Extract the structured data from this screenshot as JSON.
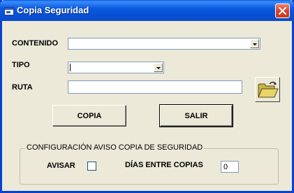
{
  "window": {
    "title": "Copia Seguridad",
    "icons": {
      "app": "app-window-icon",
      "close": "close-icon"
    }
  },
  "form": {
    "contenido": {
      "label": "CONTENIDO",
      "value": ""
    },
    "tipo": {
      "label": "TIPO",
      "value": ""
    },
    "ruta": {
      "label": "RUTA",
      "value": "",
      "browse_icon": "open-folder-icon"
    }
  },
  "buttons": {
    "copia": "COPIA",
    "salir": "SALIR"
  },
  "group": {
    "legend": "CONFIGURACIÓN AVISO COPIA DE SEGURIDAD",
    "avisar": {
      "label": "AVISAR",
      "checked": false
    },
    "dias": {
      "label": "DÍAS ENTRE COPIAS",
      "value": "0"
    }
  },
  "colors": {
    "titlebar": "#0a5ae0",
    "dialog_bg": "#ece9d8",
    "close_button": "#d9442a"
  }
}
